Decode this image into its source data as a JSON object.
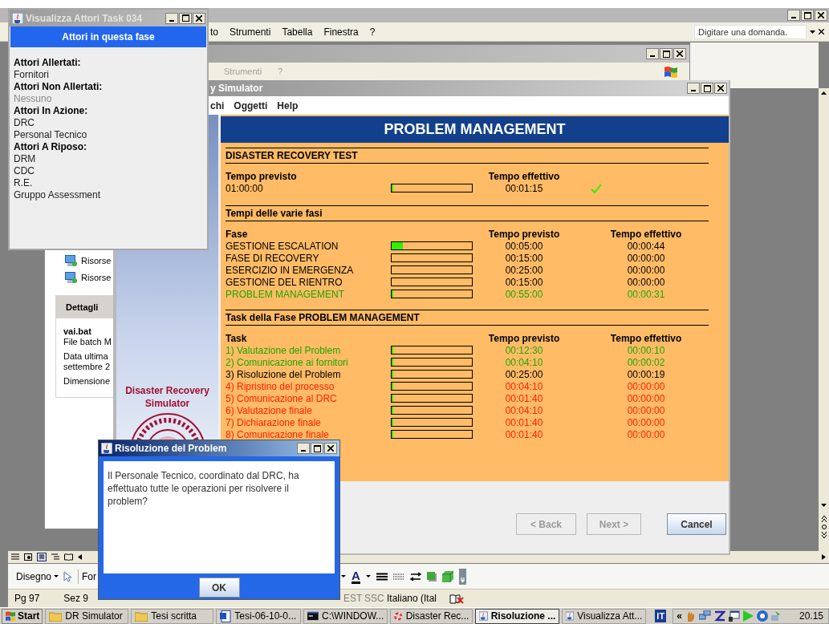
{
  "word_window": {
    "menu": [
      "to",
      "Strumenti",
      "Tabella",
      "Finestra",
      "?"
    ],
    "question_field": {
      "placeholder": "Digitare una domanda."
    },
    "drawing_toolbar": {
      "draw_menu": "Disegno",
      "format_menu": "For",
      "font_color": "A"
    },
    "status_bar": [
      "Pg 97",
      "Sez 9",
      "EST",
      "SSC",
      "Italiano (Ital"
    ]
  },
  "explorer_window": {
    "menu": [
      "Strumenti",
      "?"
    ],
    "links": [
      "Risorse",
      "Risorse"
    ],
    "details": {
      "title": "Dettagli",
      "file_name": "vai.bat",
      "lines": [
        "File batch M",
        "Data ultima",
        "settembre 2",
        "Dimensione"
      ]
    }
  },
  "simulator_window": {
    "title": "y Simulator",
    "menu": [
      "chi",
      "Oggetti",
      "Help"
    ],
    "brand": "Disaster Recovery Simulator",
    "header": "PROBLEM MANAGEMENT",
    "test": {
      "title": "DISASTER RECOVERY TEST",
      "planned_label": "Tempo previsto",
      "planned": "01:00:00",
      "level": 0.02,
      "actual_label": "Tempo effettivo",
      "actual": "00:01:15",
      "on_time": true
    },
    "phases": {
      "title": "Tempi delle varie fasi",
      "columns": [
        "Fase",
        "Tempo previsto",
        "Tempo effettivo"
      ],
      "rows": [
        {
          "name": "GESTIONE ESCALATION",
          "color": "#000000",
          "level": 0.14,
          "planned": "00:05:00",
          "actual": "00:00:44"
        },
        {
          "name": "FASE DI RECOVERY",
          "color": "#000000",
          "level": 0,
          "planned": "00:15:00",
          "actual": "00:00:00"
        },
        {
          "name": "ESERCIZIO IN EMERGENZA",
          "color": "#000000",
          "level": 0,
          "planned": "00:25:00",
          "actual": "00:00:00"
        },
        {
          "name": "GESTIONE DEL RIENTRO",
          "color": "#000000",
          "level": 0,
          "planned": "00:15:00",
          "actual": "00:00:00"
        },
        {
          "name": "PROBLEM MANAGEMENT",
          "color": "#1fa800",
          "level": 0.01,
          "planned": "00:55:00",
          "actual": "00:00:31"
        }
      ]
    },
    "tasks": {
      "title": "Task della Fase PROBLEM MANAGEMENT",
      "columns": [
        "Task",
        "Tempo previsto",
        "Tempo effettivo"
      ],
      "rows": [
        {
          "name": "1) Valutazione del Problem",
          "color": "#1fa800",
          "level": 0.01,
          "planned": "00:12:30",
          "actual": "00:00:10"
        },
        {
          "name": "2) Comunicazione ai fornitori",
          "color": "#1fa800",
          "level": 0.01,
          "planned": "00:04:10",
          "actual": "00:00:02"
        },
        {
          "name": "3) Risoluzione del Problem",
          "color": "#000000",
          "level": 0.01,
          "planned": "00:25:00",
          "actual": "00:00:19"
        },
        {
          "name": "4) Ripristino del processo",
          "color": "#ff2200",
          "level": 0.01,
          "planned": "00:04:10",
          "actual": "00:00:00"
        },
        {
          "name": "5) Comunicazione al DRC",
          "color": "#ff2200",
          "level": 0.01,
          "planned": "00:01:40",
          "actual": "00:00:00"
        },
        {
          "name": "6) Valutazione finale",
          "color": "#ff2200",
          "level": 0.01,
          "planned": "00:04:10",
          "actual": "00:00:00"
        },
        {
          "name": "7) Dichiarazione finale",
          "color": "#ff2200",
          "level": 0.01,
          "planned": "00:01:40",
          "actual": "00:00:00"
        },
        {
          "name": "8) Comunicazione finale",
          "color": "#ff2200",
          "level": 0.01,
          "planned": "00:01:40",
          "actual": "00:00:00"
        }
      ]
    },
    "buttons": [
      {
        "label": "< Back",
        "disabled": true
      },
      {
        "label": "Next >",
        "disabled": true
      },
      {
        "label": "Cancel",
        "disabled": false
      }
    ]
  },
  "actors_window": {
    "title": "Visualizza Attori Task 034",
    "header": "Attori in questa fase",
    "groups": [
      {
        "label": "Attori Allertati:",
        "empty": false,
        "actors": [
          "Fornitori"
        ]
      },
      {
        "label": "Attori Non Allertati:",
        "empty": true,
        "actors": [
          "Nessuno"
        ]
      },
      {
        "label": "Attori In Azione:",
        "empty": false,
        "actors": [
          "DRC",
          "Personal Tecnico"
        ]
      },
      {
        "label": "Attori A Riposo:",
        "empty": false,
        "actors": [
          "DRM",
          "CDC",
          "R.E.",
          "Gruppo Assessment"
        ]
      }
    ]
  },
  "dialog": {
    "title": "Risoluzione del Problem",
    "message": "Il Personale Tecnico, coordinato dal DRC, ha effettuato tutte le operazioni per risolvere il problem?",
    "button": "OK"
  },
  "taskbar": {
    "start": "Start",
    "items": [
      {
        "label": "DR Simulator",
        "kind": "folder",
        "selected": false
      },
      {
        "label": "Tesi scritta",
        "kind": "folder",
        "selected": false
      },
      {
        "label": "Tesi-06-10-0...",
        "kind": "document",
        "selected": false
      },
      {
        "label": "C:\\WINDOW...",
        "kind": "console",
        "selected": false
      },
      {
        "label": "Disaster Rec...",
        "kind": "lifebuoy",
        "selected": false
      },
      {
        "label": "Risoluzione ...",
        "kind": "java",
        "selected": true
      },
      {
        "label": "Visualizza Att...",
        "kind": "java",
        "selected": false
      }
    ],
    "language": "IT",
    "expand": "«",
    "clock": "20.15"
  }
}
